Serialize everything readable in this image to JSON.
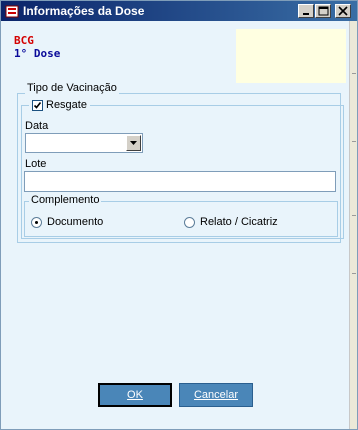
{
  "window": {
    "title": "Informações da Dose",
    "controls": [
      "minimize",
      "maximize",
      "close"
    ]
  },
  "vaccine": {
    "name": "BCG",
    "dose": "1° Dose"
  },
  "form": {
    "group_title": "Tipo de Vacinação",
    "resgate": {
      "label": "Resgate",
      "checked": true
    },
    "data": {
      "label": "Data",
      "value": ""
    },
    "lote": {
      "label": "Lote",
      "value": ""
    },
    "complemento": {
      "title": "Complemento",
      "options": [
        {
          "label": "Documento",
          "selected": true
        },
        {
          "label": "Relato / Cicatriz",
          "selected": false
        }
      ]
    }
  },
  "buttons": {
    "ok": "OK",
    "cancel": "Cancelar"
  },
  "colors": {
    "vaccine_name": "#d40000",
    "dose_name": "#0a0a9a",
    "button_bg": "#4a86b8",
    "panel_bg": "#e9f4fb"
  }
}
